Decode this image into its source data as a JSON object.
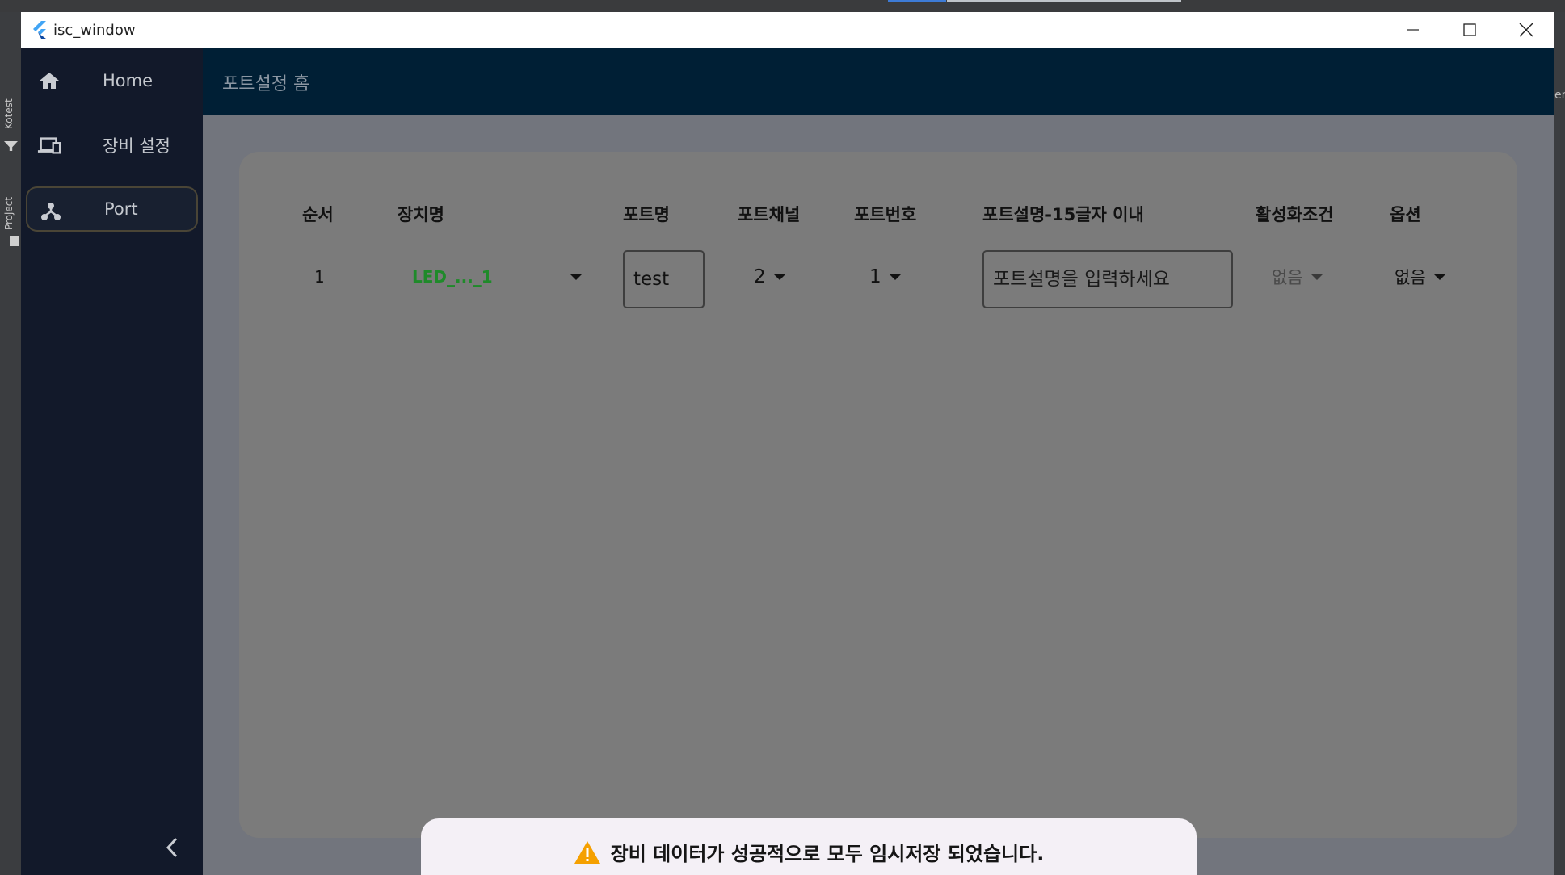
{
  "window": {
    "title": "isc_window"
  },
  "sidebar": {
    "items": [
      {
        "label": "Home",
        "icon": "home-icon"
      },
      {
        "label": "장비 설정",
        "icon": "devices-icon"
      },
      {
        "label": "Port",
        "icon": "hub-icon",
        "selected": true
      }
    ]
  },
  "appbar": {
    "title": "포트설정 홈"
  },
  "table": {
    "headers": {
      "seq": "순서",
      "device": "장치명",
      "port_name": "포트명",
      "port_channel": "포트채널",
      "port_number": "포트번호",
      "port_desc": "포트설명-15글자 이내",
      "activation": "활성화조건",
      "option": "옵션"
    },
    "rows": [
      {
        "seq": "1",
        "device": "LED_..._1",
        "port_name": "test",
        "port_channel": "2",
        "port_number": "1",
        "port_desc_placeholder": "포트설명을 입력하세요",
        "activation": "없음",
        "option": "없음"
      }
    ]
  },
  "snackbar": {
    "message": "장비 데이터가 성공적으로 모두 임시저장 되었습니다.",
    "icon": "warning-icon"
  },
  "colors": {
    "sidebar_bg": "#12192a",
    "appbar_bg": "#001f35",
    "device_text": "#1f8a2a",
    "warning": "#f5a000"
  },
  "desktop": {
    "left_labels": [
      "Kotest",
      "Project"
    ],
    "right_label": "er"
  }
}
